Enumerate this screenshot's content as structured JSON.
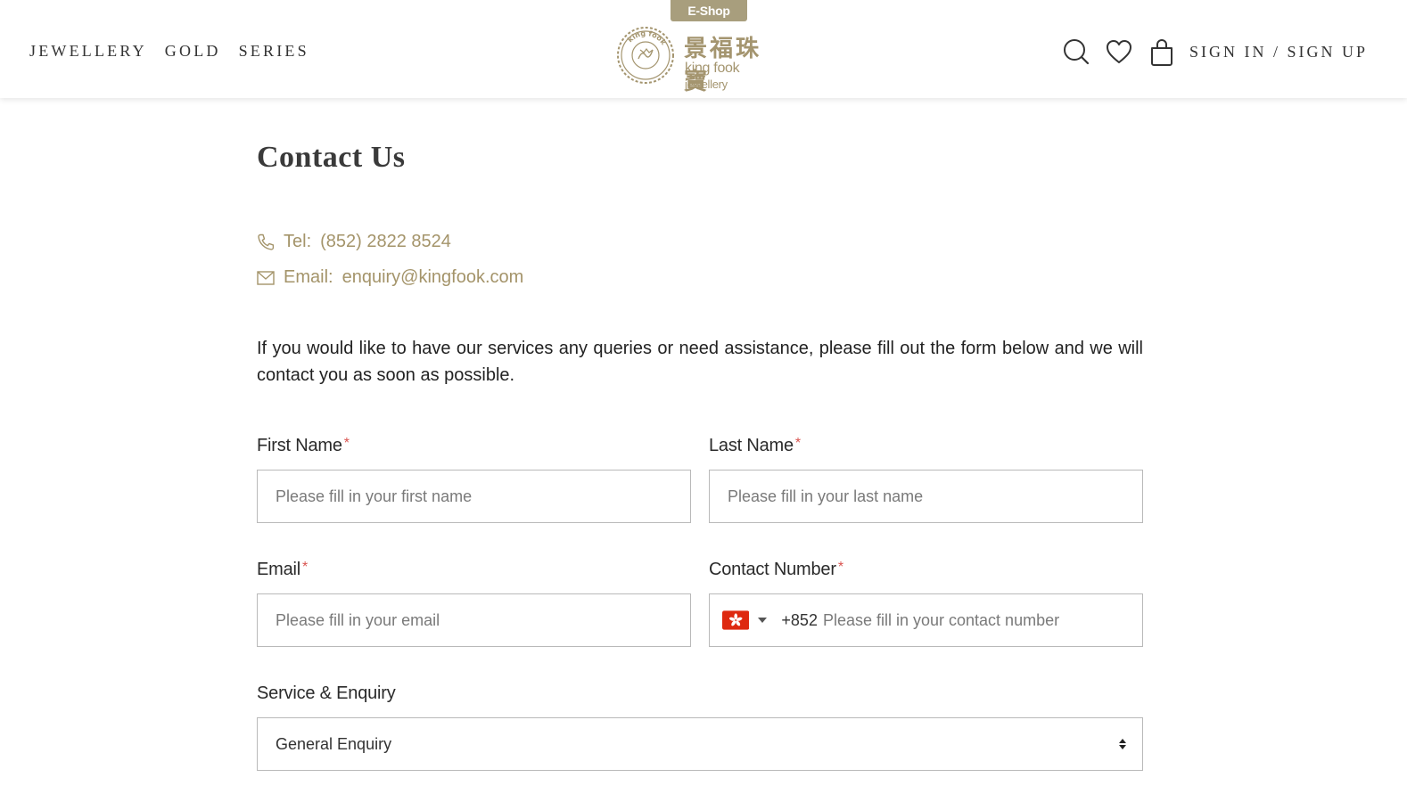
{
  "header": {
    "nav": [
      "JEWELLERY",
      "GOLD",
      "SERIES"
    ],
    "eshop_label": "E-Shop",
    "logo_cn": "景福珠寶",
    "logo_en": "king fook",
    "logo_en_small": "jewellery",
    "logo_seal_text": "king fook",
    "sign_label": "SIGN IN / SIGN UP",
    "icons": [
      "search-icon",
      "heart-icon",
      "bag-icon"
    ]
  },
  "main": {
    "title": "Contact Us",
    "tel_label": "Tel:",
    "tel_value": "(852) 2822 8524",
    "email_label": "Email:",
    "email_value": "enquiry@kingfook.com",
    "intro": "If you would like to have our services any queries or need assistance, please fill out the form below and we will contact you as soon as possible."
  },
  "form": {
    "first_name": {
      "label": "First Name",
      "placeholder": "Please fill in your first name"
    },
    "last_name": {
      "label": "Last Name",
      "placeholder": "Please fill in your last name"
    },
    "email": {
      "label": "Email",
      "placeholder": "Please fill in your email"
    },
    "contact": {
      "label": "Contact Number",
      "dial_code": "+852",
      "placeholder": "Please fill in your contact number",
      "flag": "hong-kong-flag"
    },
    "service": {
      "label": "Service & Enquiry",
      "value": "General Enquiry"
    },
    "required_mark": "*"
  },
  "colors": {
    "accent": "#a4946a",
    "eshop_bg": "#a89e7d",
    "required": "#d9534f",
    "flag_red": "#de2910"
  }
}
